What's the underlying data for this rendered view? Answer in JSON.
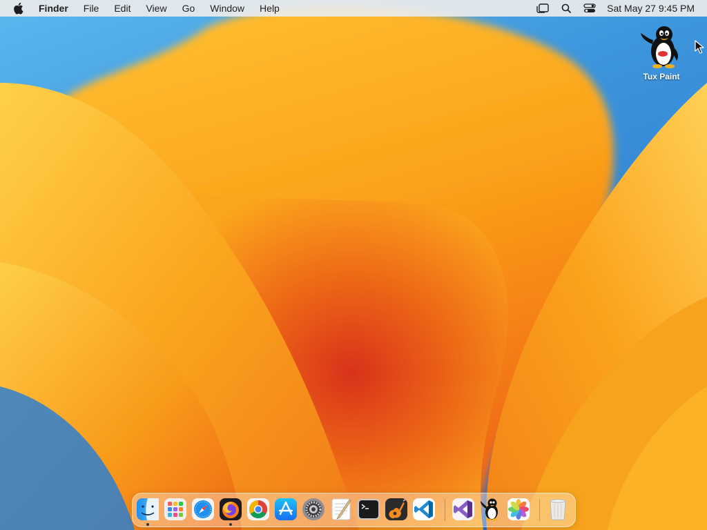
{
  "menubar": {
    "apple_icon": "apple-logo-icon",
    "app_name": "Finder",
    "items": [
      "File",
      "Edit",
      "View",
      "Go",
      "Window",
      "Help"
    ],
    "status_icons": [
      "stage-manager-icon",
      "spotlight-search-icon",
      "control-center-icon"
    ],
    "clock": "Sat May 27  9:45 PM"
  },
  "desktop": {
    "icons": [
      {
        "label": "Tux Paint",
        "icon": "tux-penguin-icon"
      }
    ]
  },
  "dock": {
    "apps": [
      {
        "name": "Finder",
        "icon": "finder-icon",
        "running": true
      },
      {
        "name": "Launchpad",
        "icon": "launchpad-icon",
        "running": false
      },
      {
        "name": "Safari",
        "icon": "safari-icon",
        "running": false
      },
      {
        "name": "Firefox",
        "icon": "firefox-icon",
        "running": true
      },
      {
        "name": "Chrome",
        "icon": "chrome-icon",
        "running": false
      },
      {
        "name": "App Store",
        "icon": "app-store-icon",
        "running": false
      },
      {
        "name": "System Settings",
        "icon": "system-settings-icon",
        "running": false
      },
      {
        "name": "TextEdit",
        "icon": "textedit-icon",
        "running": false
      },
      {
        "name": "Terminal",
        "icon": "terminal-icon",
        "running": false
      },
      {
        "name": "GarageBand",
        "icon": "garageband-icon",
        "running": false
      },
      {
        "name": "Visual Studio Code",
        "icon": "vscode-icon",
        "running": false
      },
      {
        "name": "Visual Studio",
        "icon": "visual-studio-icon",
        "running": false
      },
      {
        "name": "Tux Paint",
        "icon": "tux-paint-icon",
        "running": false
      },
      {
        "name": "Photos",
        "icon": "photos-icon",
        "running": false
      },
      {
        "name": "Trash",
        "icon": "trash-icon",
        "running": false
      }
    ]
  },
  "colors": {
    "menubar_bg": "#ececec",
    "wallpaper_orange": "#f7a21b",
    "wallpaper_blue": "#3d95dc"
  }
}
